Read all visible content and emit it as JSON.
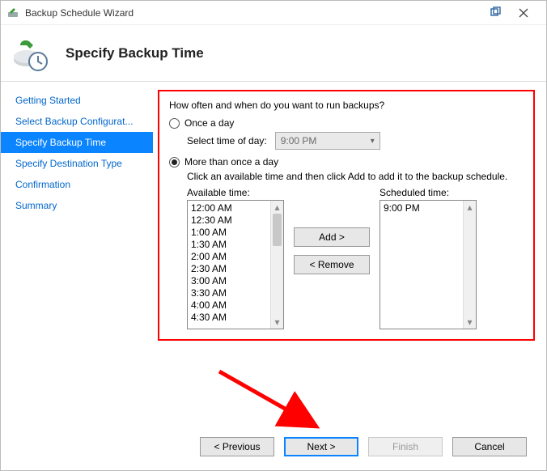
{
  "window": {
    "title": "Backup Schedule Wizard"
  },
  "header": {
    "title": "Specify Backup Time"
  },
  "sidebar": {
    "steps": [
      "Getting Started",
      "Select Backup Configurat...",
      "Specify Backup Time",
      "Specify Destination Type",
      "Confirmation",
      "Summary"
    ],
    "active_index": 2
  },
  "content": {
    "prompt": "How often and when do you want to run backups?",
    "option_once": {
      "label": "Once a day",
      "selected": false,
      "time_label": "Select time of day:",
      "time_value": "9:00 PM"
    },
    "option_multi": {
      "label": "More than once a day",
      "selected": true,
      "instruction": "Click an available time and then click Add to add it to the backup schedule.",
      "available_label": "Available time:",
      "scheduled_label": "Scheduled time:",
      "available_times": [
        "12:00 AM",
        "12:30 AM",
        "1:00 AM",
        "1:30 AM",
        "2:00 AM",
        "2:30 AM",
        "3:00 AM",
        "3:30 AM",
        "4:00 AM",
        "4:30 AM"
      ],
      "scheduled_times": [
        "9:00 PM"
      ],
      "add_label": "Add >",
      "remove_label": "< Remove"
    }
  },
  "footer": {
    "previous": "< Previous",
    "next": "Next >",
    "finish": "Finish",
    "cancel": "Cancel"
  }
}
